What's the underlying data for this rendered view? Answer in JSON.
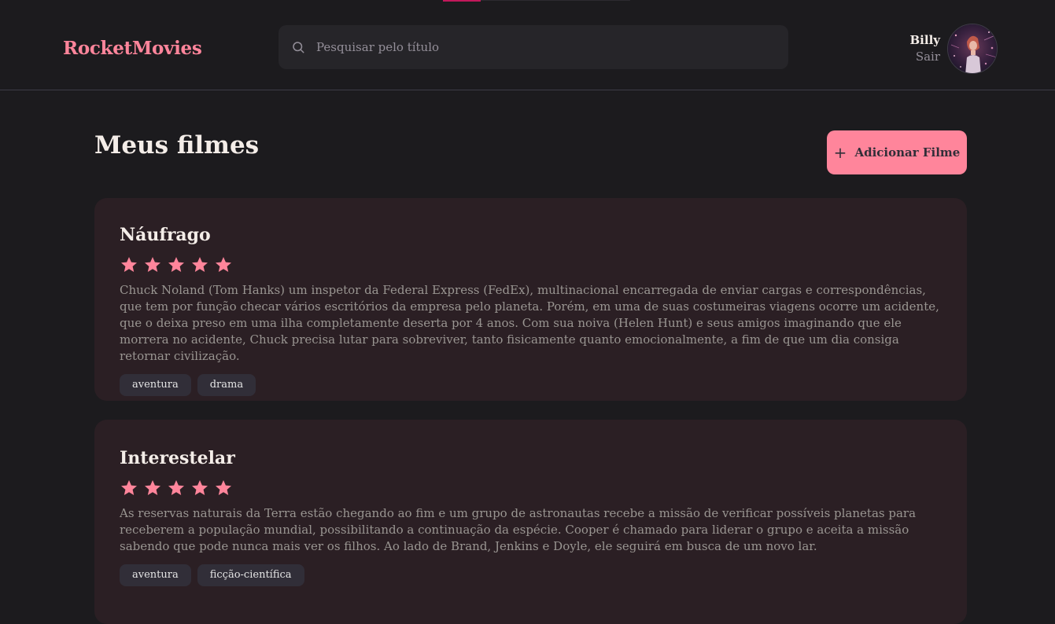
{
  "header": {
    "brand": "RocketMovies",
    "search_placeholder": "Pesquisar pelo título",
    "search_value": "",
    "search_icon": "search-icon",
    "profile": {
      "name": "Billy",
      "logout_label": "Sair"
    }
  },
  "main": {
    "title": "Meus filmes",
    "add_button": {
      "icon": "plus-icon",
      "label": "Adicionar Filme"
    },
    "movies": [
      {
        "title": "Náufrago",
        "rating": 5,
        "rating_max": 5,
        "description": "Chuck Noland (Tom Hanks) um inspetor da Federal Express (FedEx), multinacional encarregada de enviar cargas e correspondências, que tem por função checar vários escritórios da empresa pelo planeta. Porém, em uma de suas costumeiras viagens ocorre um acidente, que o deixa preso em uma ilha completamente deserta por 4 anos. Com sua noiva (Helen Hunt) e seus amigos imaginando que ele morrera no acidente, Chuck precisa lutar para sobreviver, tanto fisicamente quanto emocionalmente, a fim de que um dia consiga retornar civilização.",
        "tags": [
          "aventura",
          "drama"
        ]
      },
      {
        "title": "Interestelar",
        "rating": 5,
        "rating_max": 5,
        "description": "As reservas naturais da Terra estão chegando ao fim e um grupo de astronautas recebe a missão de verificar possíveis planetas para receberem a população mundial, possibilitando a continuação da espécie. Cooper é chamado para liderar o grupo e aceita a missão sabendo que pode nunca mais ver os filhos. Ao lado de Brand, Jenkins e Doyle, ele seguirá em busca de um novo lar.",
        "tags": [
          "aventura",
          "ficção-científica"
        ]
      }
    ]
  },
  "colors": {
    "background": "#1c1b1e",
    "accent": "#ff859b",
    "card": "#2b1f24",
    "tag": "#312e38",
    "input": "#262529"
  }
}
